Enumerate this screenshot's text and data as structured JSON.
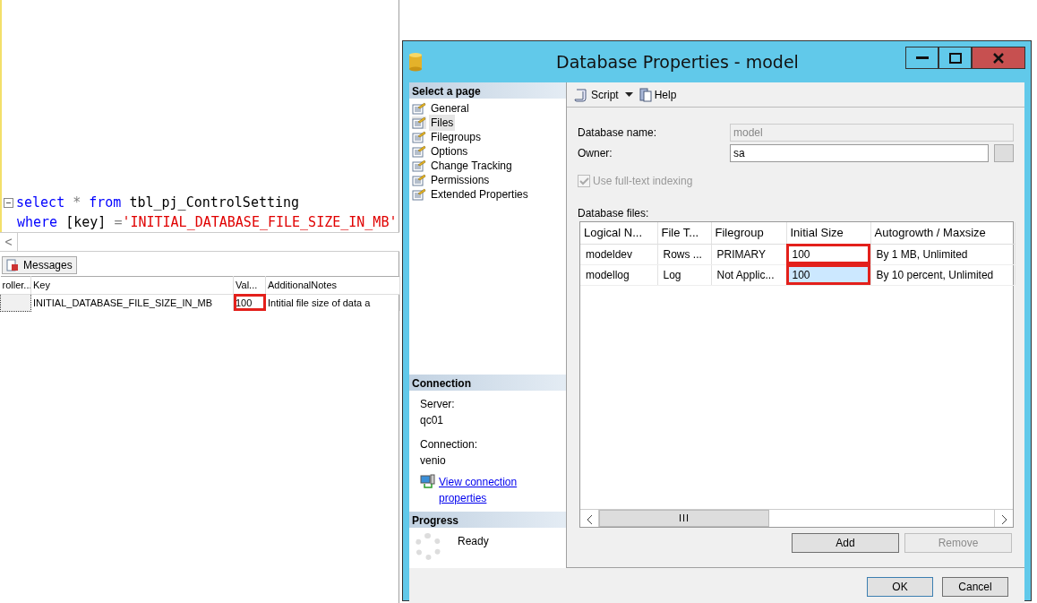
{
  "editor": {
    "lines": [
      {
        "collapse": true,
        "tokens": [
          {
            "kind": "keyword",
            "text": "select"
          },
          {
            "kind": "operator",
            "text": " * "
          },
          {
            "kind": "keyword",
            "text": "from"
          },
          {
            "kind": "plain",
            "text": " tbl_pj_ControlSetting"
          }
        ]
      },
      {
        "collapse": false,
        "tokens": [
          {
            "kind": "keyword",
            "text": "where"
          },
          {
            "kind": "plain",
            "text": " [key] "
          },
          {
            "kind": "operator",
            "text": "="
          },
          {
            "kind": "string",
            "text": "'INITIAL_DATABASE_FILE_SIZE_IN_MB'"
          }
        ]
      }
    ],
    "scroll_left": "<"
  },
  "results": {
    "tab": "Messages",
    "columns": [
      "roller...",
      "Key",
      "Val...",
      "AdditionalNotes"
    ],
    "rows": [
      {
        "key": "INITIAL_DATABASE_FILE_SIZE_IN_MB",
        "value": "100",
        "value_highlighted": true,
        "notes": "Intitial file size of data a"
      }
    ]
  },
  "dialog": {
    "title": "Database Properties - model",
    "sidebar": {
      "header": "Select a page",
      "pages": [
        {
          "label": "General",
          "selected": false
        },
        {
          "label": "Files",
          "selected": true
        },
        {
          "label": "Filegroups",
          "selected": false
        },
        {
          "label": "Options",
          "selected": false
        },
        {
          "label": "Change Tracking",
          "selected": false
        },
        {
          "label": "Permissions",
          "selected": false
        },
        {
          "label": "Extended Properties",
          "selected": false
        }
      ],
      "connection": {
        "header": "Connection",
        "server_label": "Server:",
        "server": "qc01",
        "connection_label": "Connection:",
        "connection": "venio",
        "link": "View connection properties"
      },
      "progress": {
        "header": "Progress",
        "status": "Ready"
      }
    },
    "toolbar": {
      "script": "Script",
      "help": "Help"
    },
    "form": {
      "name_label": "Database name:",
      "name_value": "model",
      "owner_label": "Owner:",
      "owner_value": "sa",
      "fulltext": {
        "label": "Use full-text indexing",
        "checked": true,
        "disabled": true
      }
    },
    "files": {
      "label": "Database files:",
      "columns": [
        "Logical N...",
        "File T...",
        "Filegroup",
        "Initial Size",
        "Autogrowth / Maxsize"
      ],
      "rows": [
        {
          "cells": [
            "modeldev",
            "Rows ...",
            "PRIMARY",
            "100",
            "By 1 MB, Unlimited"
          ],
          "selected": false,
          "size_highlighted": true
        },
        {
          "cells": [
            "modellog",
            "Log",
            "Not Applic...",
            "100",
            "By 10 percent, Unlimited"
          ],
          "selected": true,
          "size_highlighted": true
        }
      ],
      "scroll_thumb": "III"
    },
    "buttons": [
      {
        "label": "Add",
        "disabled": false
      },
      {
        "label": "Remove",
        "disabled": true
      }
    ],
    "footer": [
      {
        "label": "OK",
        "default": true
      },
      {
        "label": "Cancel",
        "default": false
      }
    ]
  }
}
